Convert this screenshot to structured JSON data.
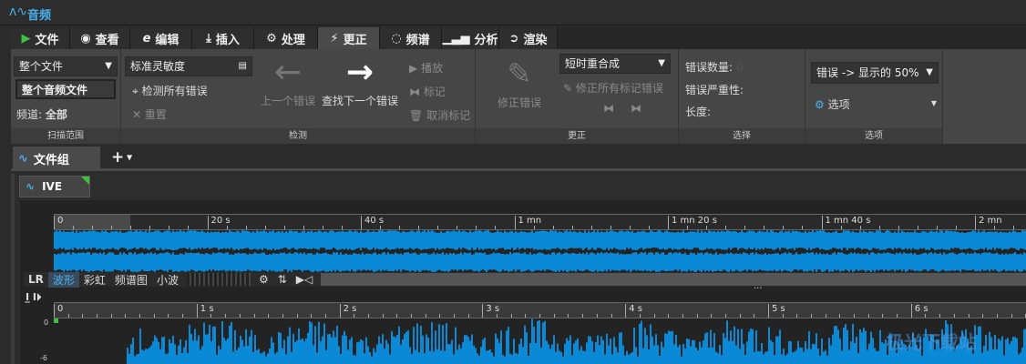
{
  "window": {
    "title": "音频"
  },
  "tabs": [
    {
      "label": "文件",
      "icon": "wavelab-logo-icon"
    },
    {
      "label": "查看",
      "icon": "eye-icon"
    },
    {
      "label": "编辑",
      "icon": "edit-e-icon"
    },
    {
      "label": "插入",
      "icon": "insert-icon"
    },
    {
      "label": "处理",
      "icon": "gears-icon"
    },
    {
      "label": "更正",
      "icon": "lightning-icon",
      "active": true
    },
    {
      "label": "频谱",
      "icon": "spectrum-icon"
    },
    {
      "label": "分析",
      "icon": "bar-chart-icon"
    },
    {
      "label": "渲染",
      "icon": "render-icon"
    }
  ],
  "ribbon": {
    "scan": {
      "label": "扫描范围",
      "range": "整个文件",
      "scope": "整个音频文件",
      "channel_label": "频道:",
      "channel": "全部"
    },
    "detect": {
      "label": "检测",
      "sensitivity": "标准灵敏度",
      "detect_all": "检测所有错误",
      "reset": "重置",
      "prev": "上一个错误",
      "next": "查找下一个错误",
      "play": "播放",
      "mark": "标记",
      "unmark": "取消标记"
    },
    "correct": {
      "label": "更正",
      "fix": "修正错误",
      "method": "短时重合成",
      "fix_all": "修正所有标记错误"
    },
    "select": {
      "label": "选择",
      "count_label": "错误数量:",
      "count": "0",
      "severity_label": "错误严重性:",
      "length_label": "长度:"
    },
    "options": {
      "label": "选项",
      "display": "错误 -> 显示的 50%",
      "options": "选项"
    }
  },
  "doc": {
    "tab": "文件组",
    "add": "+",
    "track": "IVE"
  },
  "overview": {
    "ruler": [
      "0",
      "20 s",
      "40 s",
      "1 mn",
      "1 mn 20 s",
      "1 mn 40 s",
      "2 mn"
    ],
    "toolbar": {
      "lr": "LR",
      "modes": [
        "波形",
        "彩虹",
        "频谱图",
        "小波"
      ],
      "active": "波形"
    }
  },
  "main": {
    "ruler": [
      "0",
      "1 s",
      "2 s",
      "3 s",
      "4 s",
      "5 s",
      "6 s"
    ],
    "db": [
      "0",
      "-6"
    ],
    "splitter": "..."
  },
  "watermark": "极光下载站",
  "colors": {
    "wave": "#0a8ad6",
    "accent": "#4ab0f0",
    "green": "#3fc040"
  }
}
